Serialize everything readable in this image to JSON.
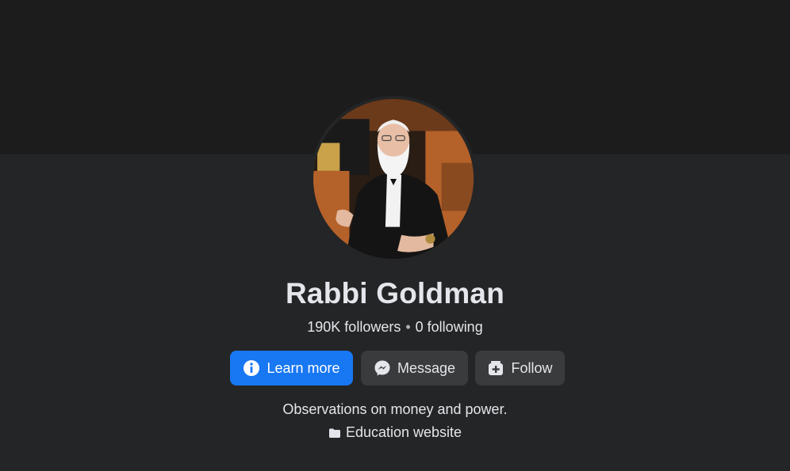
{
  "profile": {
    "name": "Rabbi Goldman",
    "followers": "190K followers",
    "separator": "•",
    "following": "0 following",
    "bio": "Observations on money and power.",
    "category": "Education website"
  },
  "actions": {
    "learn_more": "Learn more",
    "message": "Message",
    "follow": "Follow"
  },
  "icons": {
    "learn_more": "info-icon",
    "message": "messenger-icon",
    "follow": "follow-icon",
    "category": "folder-icon"
  },
  "colors": {
    "primary": "#1877f2",
    "secondary_button": "#3a3b3c",
    "background": "#242526",
    "cover": "#1c1c1d",
    "text": "#e4e6eb"
  }
}
